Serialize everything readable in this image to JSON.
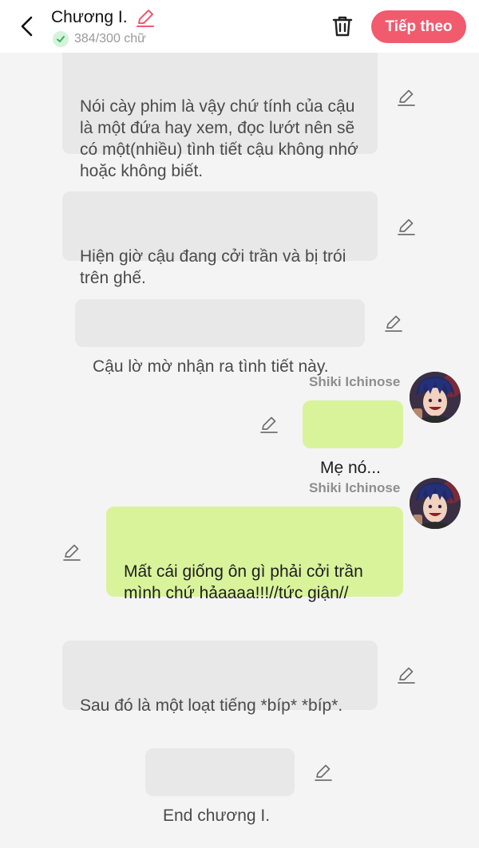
{
  "header": {
    "title": "Chương I.",
    "word_count": "384/300 chữ",
    "next_label": "Tiếp theo",
    "accent": "#f25a6e"
  },
  "messages": [
    {
      "type": "narration",
      "text": "Nói cày phim là vậy chứ tính của cậu là một đứa hay xem, đọc lướt nên sẽ có một(nhiều) tình tiết cậu không nhớ hoặc không biết."
    },
    {
      "type": "narration",
      "text": "Hiện giờ cậu đang cởi trần và bị trói trên ghế."
    },
    {
      "type": "narration",
      "text": "Cậu lờ mờ nhận ra tình tiết này."
    },
    {
      "type": "character",
      "speaker": "Shiki Ichinose",
      "text": "Mẹ nó..."
    },
    {
      "type": "character",
      "speaker": "Shiki Ichinose",
      "text": "Mất cái giống ôn gì phải cởi trần mình chứ hảaaaa!!!//tức giận//"
    },
    {
      "type": "narration",
      "text": "Sau đó là một loạt tiếng *bíp* *bíp*."
    },
    {
      "type": "narration",
      "text": "End chương I."
    }
  ]
}
